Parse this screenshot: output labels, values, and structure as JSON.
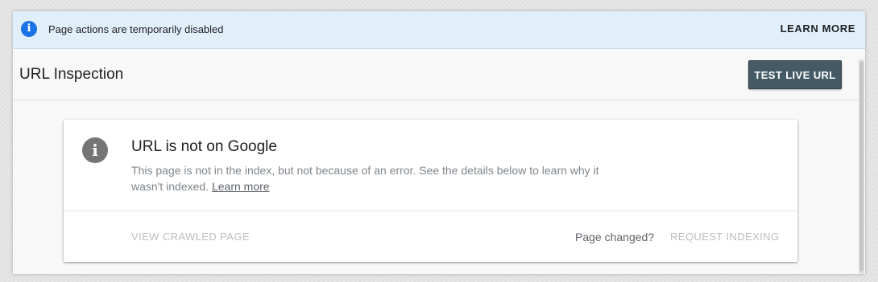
{
  "banner": {
    "icon": "info-icon",
    "text": "Page actions are temporarily disabled",
    "learn_more_label": "LEARN MORE",
    "background_color": "#e1effa",
    "icon_color": "#1a73e8"
  },
  "header": {
    "title": "URL Inspection",
    "test_live_url_label": "TEST LIVE URL",
    "button_color": "#455a64"
  },
  "status_card": {
    "icon": "info-icon",
    "title": "URL is not on Google",
    "description": "This page is not in the index, but not because of an error. See the details below to learn why it wasn't indexed.",
    "learn_more_link": "Learn more",
    "view_crawled_page_label": "VIEW CRAWLED PAGE",
    "page_changed_label": "Page changed?",
    "request_indexing_label": "REQUEST INDEXING",
    "disabled_text_color": "#bdbdbd"
  }
}
